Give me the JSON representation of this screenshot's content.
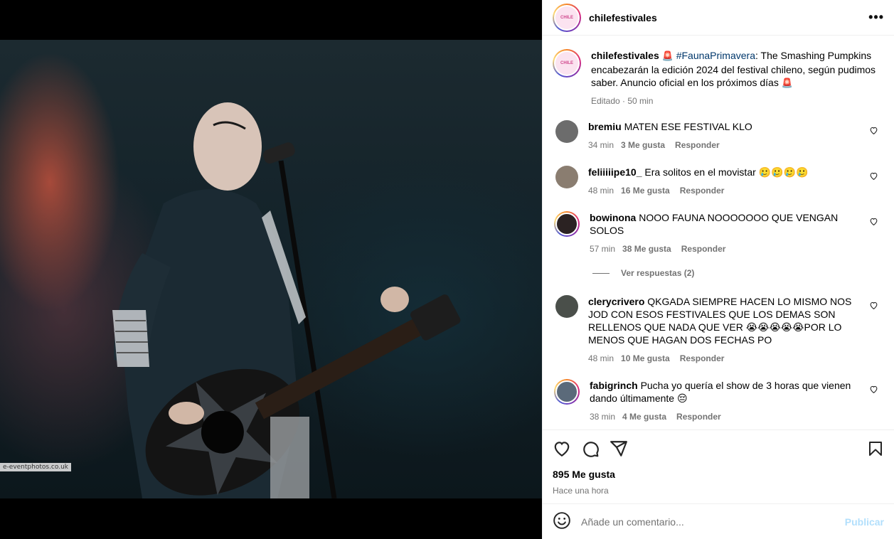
{
  "post": {
    "username": "chilefestivales",
    "logo_text": "CHILE",
    "caption_user": "chilefestivales",
    "caption_siren": "🚨",
    "hashtag": "#FaunaPrimavera",
    "caption_text": ": The Smashing Pumpkins encabezarán la edición 2024 del festival chileno, según pudimos saber. Anuncio oficial en los próximos días",
    "caption_end": "🚨",
    "caption_meta": "Editado · 50 min",
    "watermark": "e-eventphotos.co.uk"
  },
  "comments": [
    {
      "user": "bremiu",
      "text": "MATEN ESE FESTIVAL KLO",
      "time": "34 min",
      "likes": "3 Me gusta",
      "reply": "Responder",
      "avatar_color": "#6c6c6c",
      "ring": false
    },
    {
      "user": "feliiiiipe10_",
      "text": "Era solitos en el movistar 🥲🥲🥲🥲",
      "time": "48 min",
      "likes": "16 Me gusta",
      "reply": "Responder",
      "avatar_color": "#8a7d70",
      "ring": false
    },
    {
      "user": "bowinona",
      "text": "NOOO FAUNA NOOOOOOO QUE VENGAN SOLOS",
      "time": "57 min",
      "likes": "38 Me gusta",
      "reply": "Responder",
      "avatar_color": "#2b2222",
      "ring": true
    },
    {
      "user": "clerycrivero",
      "text": "QKGADA SIEMPRE HACEN LO MISMO NOS JOD CON ESOS FESTIVALES QUE LOS DEMAS SON RELLENOS QUE NADA QUE VER 😭😭😭😭😭POR LO MENOS QUE HAGAN DOS FECHAS PO",
      "time": "48 min",
      "likes": "10 Me gusta",
      "reply": "Responder",
      "avatar_color": "#4a4f4a",
      "ring": false
    },
    {
      "user": "fabigrinch",
      "text": "Pucha yo quería el show de 3 horas que vienen dando últimamente 😔",
      "time": "38 min",
      "likes": "4 Me gusta",
      "reply": "Responder",
      "avatar_color": "#5b6a7a",
      "ring": true
    }
  ],
  "view_replies": "Ver respuestas (2)",
  "actions": {
    "likes": "895 Me gusta",
    "when": "Hace una hora"
  },
  "composer": {
    "placeholder": "Añade un comentario...",
    "post": "Publicar"
  },
  "colors": {
    "hashtag": "#00376b",
    "muted": "#737373",
    "publish_disabled": "#b2dffc"
  },
  "icons": [
    "heart-icon",
    "comment-icon",
    "share-icon",
    "bookmark-icon",
    "more-icon",
    "emoji-icon"
  ]
}
